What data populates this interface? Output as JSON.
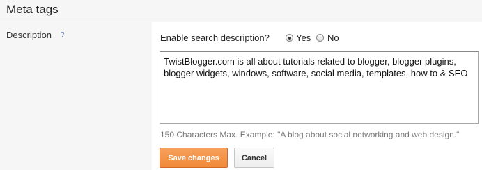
{
  "header": {
    "title": "Meta tags"
  },
  "description": {
    "label": "Description",
    "help": "?",
    "enable_label": "Enable search description?",
    "options": {
      "yes": "Yes",
      "no": "No"
    },
    "selected": "yes",
    "text": "TwistBlogger.com is all about tutorials related to blogger, blogger plugins, blogger widgets, windows, software, social media, templates, how to & SEO",
    "hint": "150 Characters Max. Example: \"A blog about social networking and web design.\""
  },
  "actions": {
    "save_label": "Save changes",
    "cancel_label": "Cancel"
  },
  "colors": {
    "save_button": "#f08a38",
    "help_link": "#5d7ec8"
  }
}
